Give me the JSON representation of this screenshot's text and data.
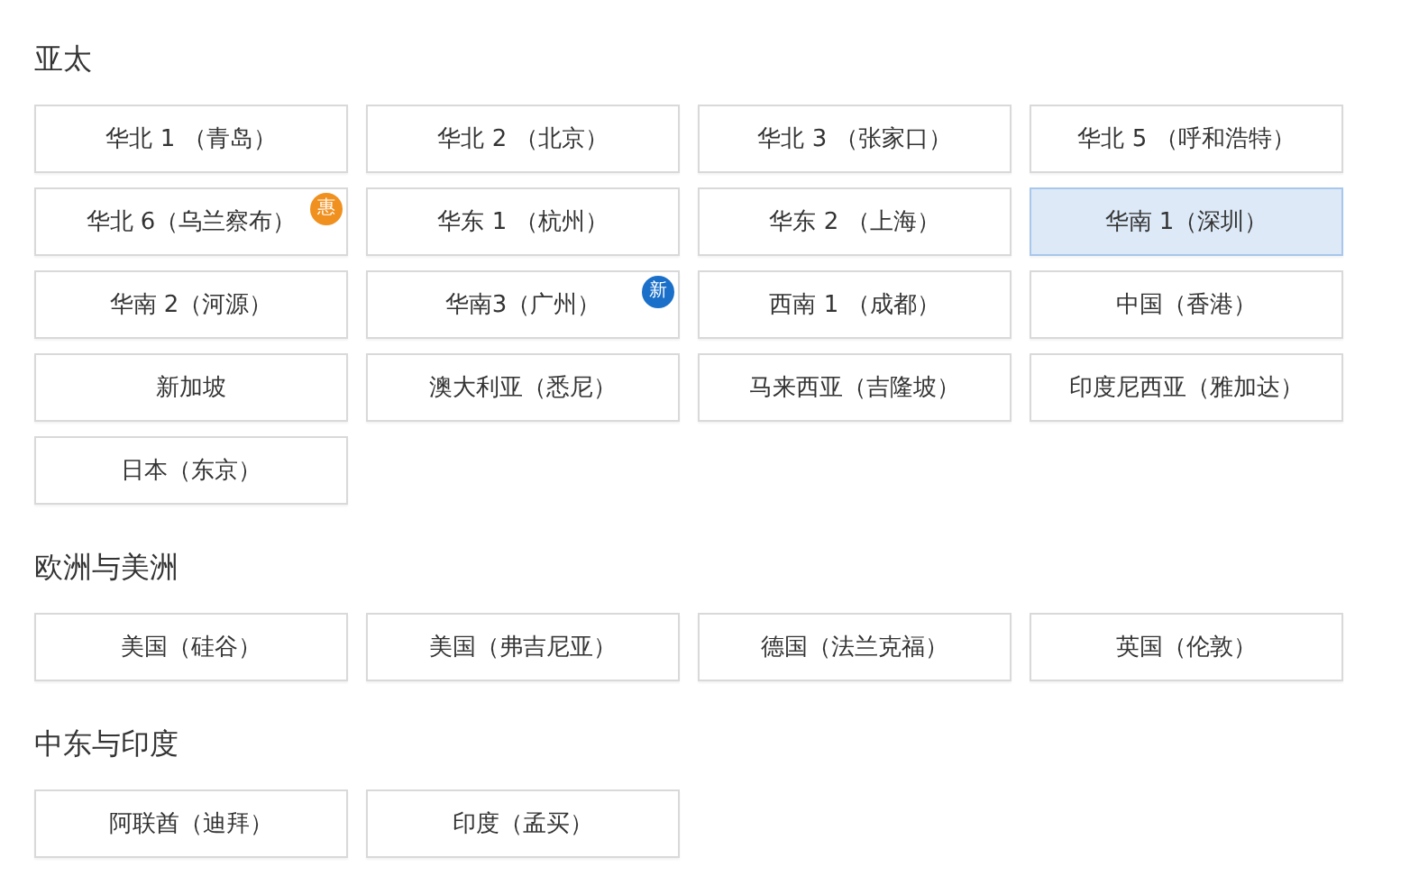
{
  "sections": [
    {
      "title": "亚太",
      "regions": [
        {
          "label": "华北 1 （青岛）",
          "selected": false
        },
        {
          "label": "华北 2 （北京）",
          "selected": false
        },
        {
          "label": "华北 3 （张家口）",
          "selected": false
        },
        {
          "label": "华北 5 （呼和浩特）",
          "selected": false
        },
        {
          "label": "华北 6（乌兰察布）",
          "selected": false,
          "badge": {
            "text": "惠",
            "color": "#f0901e"
          }
        },
        {
          "label": "华东 1 （杭州）",
          "selected": false
        },
        {
          "label": "华东 2 （上海）",
          "selected": false
        },
        {
          "label": "华南 1（深圳）",
          "selected": true
        },
        {
          "label": "华南 2（河源）",
          "selected": false
        },
        {
          "label": "华南3（广州）",
          "selected": false,
          "badge": {
            "text": "新",
            "color": "#1a6fc9"
          }
        },
        {
          "label": "西南 1 （成都）",
          "selected": false
        },
        {
          "label": "中国（香港）",
          "selected": false
        },
        {
          "label": "新加坡",
          "selected": false
        },
        {
          "label": "澳大利亚（悉尼）",
          "selected": false
        },
        {
          "label": "马来西亚（吉隆坡）",
          "selected": false
        },
        {
          "label": "印度尼西亚（雅加达）",
          "selected": false
        },
        {
          "label": "日本（东京）",
          "selected": false
        }
      ]
    },
    {
      "title": "欧洲与美洲",
      "regions": [
        {
          "label": "美国（硅谷）",
          "selected": false
        },
        {
          "label": "美国（弗吉尼亚）",
          "selected": false
        },
        {
          "label": "德国（法兰克福）",
          "selected": false
        },
        {
          "label": "英国（伦敦）",
          "selected": false
        }
      ]
    },
    {
      "title": "中东与印度",
      "regions": [
        {
          "label": "阿联酋（迪拜）",
          "selected": false
        },
        {
          "label": "印度（孟买）",
          "selected": false
        }
      ]
    }
  ]
}
